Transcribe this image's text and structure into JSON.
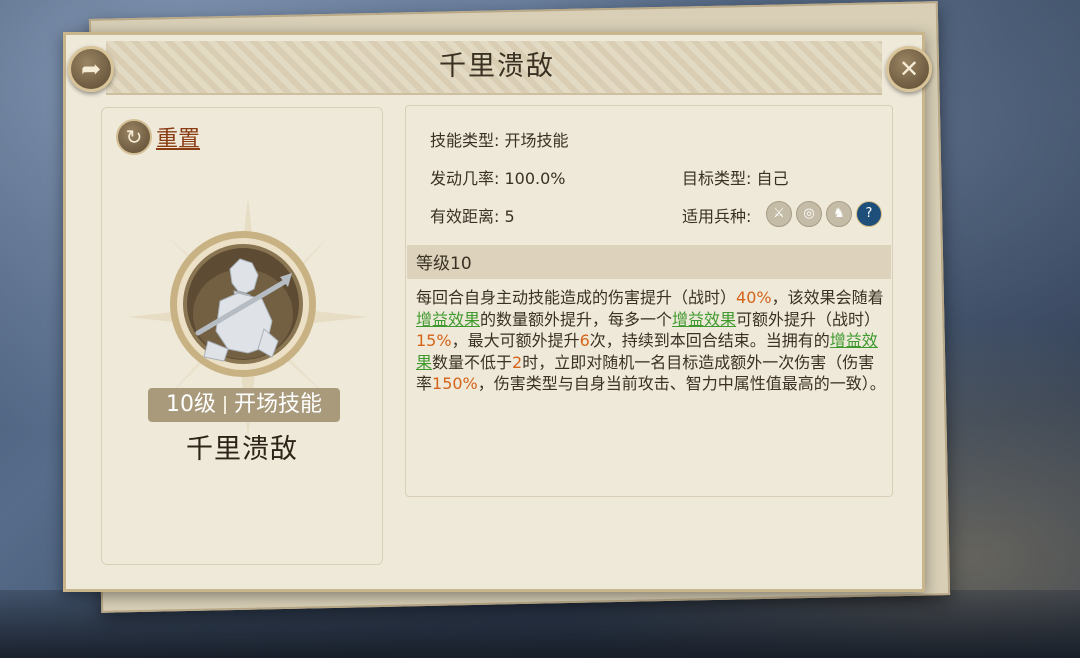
{
  "dialog": {
    "title": "千里溃敌",
    "share_icon": "share-icon",
    "close_icon": "close-icon",
    "close_glyph": "✕",
    "share_glyph": "➦"
  },
  "left": {
    "reset_label": "重置",
    "reset_icon": "reset-icon",
    "level": "10级",
    "skill_kind": "开场技能",
    "skill_name": "千里溃敌"
  },
  "info": {
    "skill_type_label": "技能类型:",
    "skill_type_value": "开场技能",
    "trigger_rate_label": "发动几率:",
    "trigger_rate_value": "100.0%",
    "target_label": "目标类型:",
    "target_value": "自己",
    "range_label": "有效距离:",
    "range_value": "5",
    "troop_label": "适用兵种:",
    "troop_icons": [
      "sword-icon",
      "target-icon",
      "horse-icon",
      "question-icon"
    ],
    "troop_glyphs": [
      "⚔",
      "◎",
      "♞",
      "?"
    ]
  },
  "level_header": "等级10",
  "description": {
    "p1": "每回合自身主动技能造成的伤害提升（战时）",
    "n1": "40%",
    "p2": "，该效果会随着",
    "l1": "增益效果",
    "p3": "的数量额外提升，每多一个",
    "l2": "增益效果",
    "p4": "可额外提升（战时）",
    "n2": "15%",
    "p5": "，最大可额外提升",
    "n3": "6",
    "p6": "次，持续到本回合结束。当拥有的",
    "l3": "增益效果",
    "p7": "数量不低于",
    "n4": "2",
    "p8": "时，立即对随机一名目标造成额外一次伤害（伤害率",
    "n5": "150%",
    "p9": "，伤害类型与自身当前攻击、智力中属性值最高的一致）。"
  },
  "colors": {
    "panel_bg": "#efe9d9",
    "number_orange": "#d5641a",
    "link_green": "#3e9a2f",
    "reset_brown": "#8a3c12",
    "level_tag_bg": "#a99a7c"
  }
}
